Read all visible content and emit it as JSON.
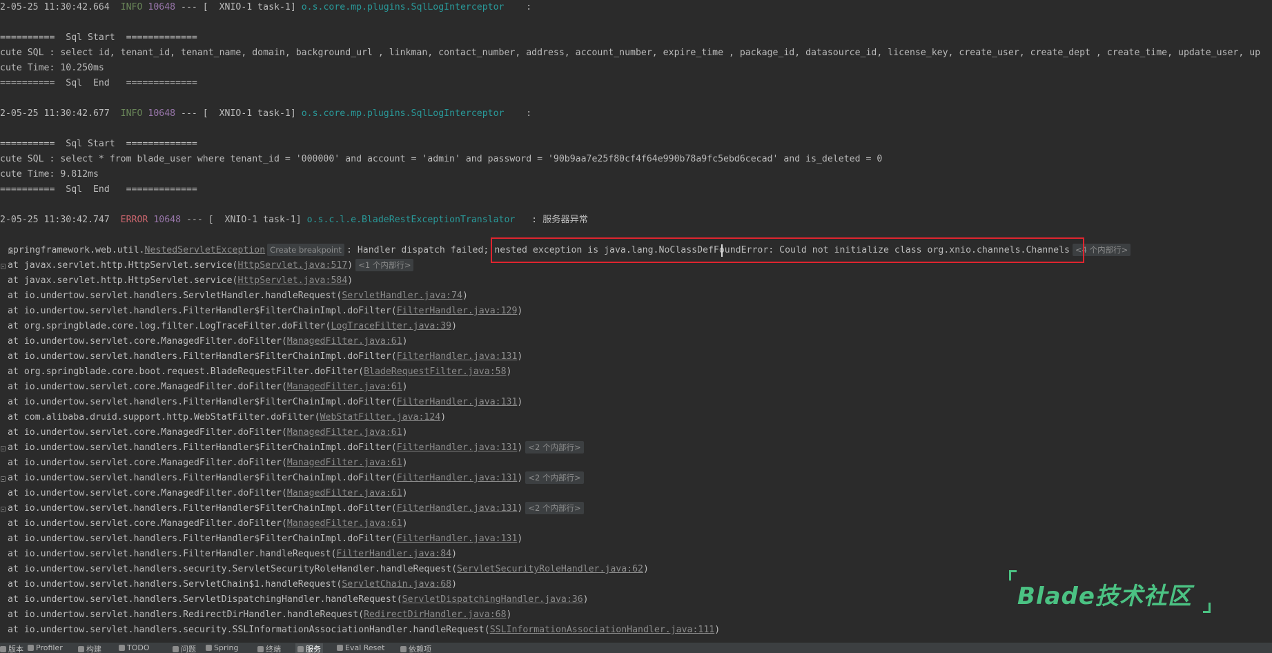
{
  "log": {
    "entry1": {
      "prefix": "2-05-25 11:30:42.664",
      "level": "INFO",
      "pid": "10648",
      "thread": " --- [  XNIO-1 task-1] ",
      "logger": "o.s.core.mp.plugins.SqlLogInterceptor",
      "sep": "    :",
      "sql_start": "==========  Sql Start  =============",
      "sql": "cute SQL : select id, tenant_id, tenant_name, domain, background_url , linkman, contact_number, address, account_number, expire_time , package_id, datasource_id, license_key, create_user, create_dept , create_time, update_user, up",
      "time": "cute Time: 10.250ms",
      "sql_end": "==========  Sql  End   ============="
    },
    "entry2": {
      "prefix": "2-05-25 11:30:42.677",
      "level": "INFO",
      "pid": "10648",
      "thread": " --- [  XNIO-1 task-1] ",
      "logger": "o.s.core.mp.plugins.SqlLogInterceptor",
      "sep": "    :",
      "sql_start": "==========  Sql Start  =============",
      "sql": "cute SQL : select * from blade_user where tenant_id = '000000' and account = 'admin' and password = '90b9aa7e25f80cf4f64e990b78a9fc5ebd6cecad' and is_deleted = 0",
      "time": "cute Time: 9.812ms",
      "sql_end": "==========  Sql  End   ============="
    },
    "entry3": {
      "prefix": "2-05-25 11:30:42.747",
      "level": "ERROR",
      "pid": "10648",
      "thread": " --- [  XNIO-1 task-1] ",
      "logger": "o.s.c.l.e.BladeRestExceptionTranslator",
      "sep": "   : ",
      "message": "服务器异常"
    },
    "exception": {
      "pre": "springframework.web.util.",
      "class_link": "NestedServletException",
      "breakpoint_tip": "Create breakpoint",
      "mid": ": Handler dispatch failed; ",
      "highlighted": "nested exception is java.lang.NoClassDefFoundError: Could not initialize class org.xnio.channels.Channels",
      "badge": "<4 个内部行>"
    },
    "stack": [
      {
        "text": "at javax.servlet.http.HttpServlet.service(",
        "src": "HttpServlet.java:517",
        "badge": "<1 个内部行>"
      },
      {
        "text": "at javax.servlet.http.HttpServlet.service(",
        "src": "HttpServlet.java:584",
        "badge": ""
      },
      {
        "text": "at io.undertow.servlet.handlers.ServletHandler.handleRequest(",
        "src": "ServletHandler.java:74",
        "badge": ""
      },
      {
        "text": "at io.undertow.servlet.handlers.FilterHandler$FilterChainImpl.doFilter(",
        "src": "FilterHandler.java:129",
        "badge": ""
      },
      {
        "text": "at org.springblade.core.log.filter.LogTraceFilter.doFilter(",
        "src": "LogTraceFilter.java:39",
        "badge": ""
      },
      {
        "text": "at io.undertow.servlet.core.ManagedFilter.doFilter(",
        "src": "ManagedFilter.java:61",
        "badge": ""
      },
      {
        "text": "at io.undertow.servlet.handlers.FilterHandler$FilterChainImpl.doFilter(",
        "src": "FilterHandler.java:131",
        "badge": ""
      },
      {
        "text": "at org.springblade.core.boot.request.BladeRequestFilter.doFilter(",
        "src": "BladeRequestFilter.java:58",
        "badge": ""
      },
      {
        "text": "at io.undertow.servlet.core.ManagedFilter.doFilter(",
        "src": "ManagedFilter.java:61",
        "badge": ""
      },
      {
        "text": "at io.undertow.servlet.handlers.FilterHandler$FilterChainImpl.doFilter(",
        "src": "FilterHandler.java:131",
        "badge": ""
      },
      {
        "text": "at com.alibaba.druid.support.http.WebStatFilter.doFilter(",
        "src": "WebStatFilter.java:124",
        "badge": ""
      },
      {
        "text": "at io.undertow.servlet.core.ManagedFilter.doFilter(",
        "src": "ManagedFilter.java:61",
        "badge": ""
      },
      {
        "text": "at io.undertow.servlet.handlers.FilterHandler$FilterChainImpl.doFilter(",
        "src": "FilterHandler.java:131",
        "badge": "<2 个内部行>"
      },
      {
        "text": "at io.undertow.servlet.core.ManagedFilter.doFilter(",
        "src": "ManagedFilter.java:61",
        "badge": ""
      },
      {
        "text": "at io.undertow.servlet.handlers.FilterHandler$FilterChainImpl.doFilter(",
        "src": "FilterHandler.java:131",
        "badge": "<2 个内部行>"
      },
      {
        "text": "at io.undertow.servlet.core.ManagedFilter.doFilter(",
        "src": "ManagedFilter.java:61",
        "badge": ""
      },
      {
        "text": "at io.undertow.servlet.handlers.FilterHandler$FilterChainImpl.doFilter(",
        "src": "FilterHandler.java:131",
        "badge": "<2 个内部行>"
      },
      {
        "text": "at io.undertow.servlet.core.ManagedFilter.doFilter(",
        "src": "ManagedFilter.java:61",
        "badge": ""
      },
      {
        "text": "at io.undertow.servlet.handlers.FilterHandler$FilterChainImpl.doFilter(",
        "src": "FilterHandler.java:131",
        "badge": ""
      },
      {
        "text": "at io.undertow.servlet.handlers.FilterHandler.handleRequest(",
        "src": "FilterHandler.java:84",
        "badge": ""
      },
      {
        "text": "at io.undertow.servlet.handlers.security.ServletSecurityRoleHandler.handleRequest(",
        "src": "ServletSecurityRoleHandler.java:62",
        "badge": ""
      },
      {
        "text": "at io.undertow.servlet.handlers.ServletChain$1.handleRequest(",
        "src": "ServletChain.java:68",
        "badge": ""
      },
      {
        "text": "at io.undertow.servlet.handlers.ServletDispatchingHandler.handleRequest(",
        "src": "ServletDispatchingHandler.java:36",
        "badge": ""
      },
      {
        "text": "at io.undertow.servlet.handlers.RedirectDirHandler.handleRequest(",
        "src": "RedirectDirHandler.java:68",
        "badge": ""
      },
      {
        "text": "at io.undertow.servlet.handlers.security.SSLInformationAssociationHandler.handleRequest(",
        "src": "SSLInformationAssociationHandler.java:111",
        "badge": ""
      }
    ]
  },
  "watermark": {
    "text": "Blade技术社区"
  },
  "status_bar": {
    "items": [
      {
        "label": "版本",
        "icon": "branch-icon"
      },
      {
        "label": "Profiler",
        "icon": "profiler-icon"
      },
      {
        "label": "构建",
        "icon": "hammer-icon"
      },
      {
        "label": "TODO",
        "icon": "list-icon"
      },
      {
        "label": "问题",
        "icon": "warning-icon"
      },
      {
        "label": "Spring",
        "icon": "leaf-icon"
      },
      {
        "label": "终端",
        "icon": "terminal-icon"
      },
      {
        "label": "服务",
        "icon": "services-icon"
      },
      {
        "label": "Eval Reset",
        "icon": "reset-icon"
      },
      {
        "label": "依赖项",
        "icon": "dependency-icon"
      }
    ]
  }
}
